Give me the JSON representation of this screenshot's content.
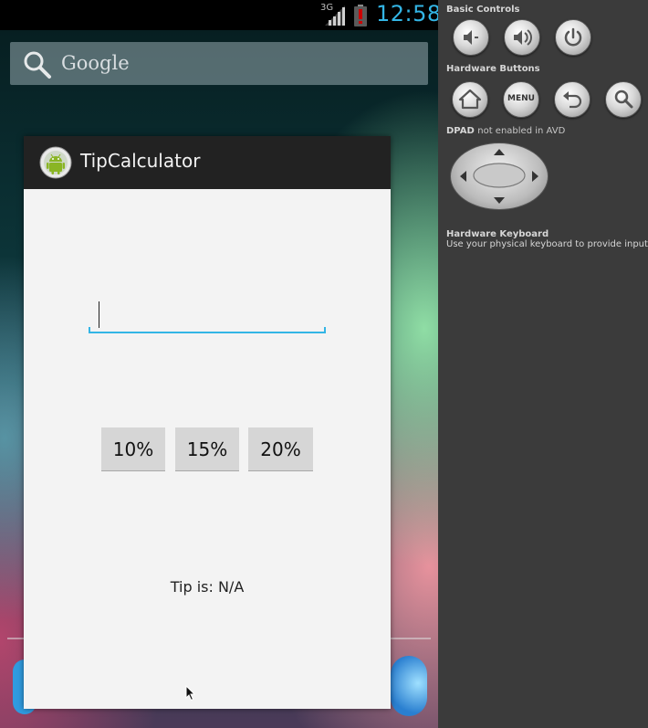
{
  "status_bar": {
    "network": "3G",
    "time": "12:58",
    "signal_icon": "signal-bars-icon",
    "battery_icon": "battery-alert-icon",
    "battery_color": "#cc0000",
    "time_color": "#33b5e5"
  },
  "home_screen": {
    "search_label": "Google",
    "search_icon": "search-icon"
  },
  "app": {
    "title": "TipCalculator",
    "icon": "android-app-icon",
    "amount_input": {
      "value": "",
      "placeholder": ""
    },
    "accent_color": "#33b5e5",
    "buttons": [
      {
        "label": "10%"
      },
      {
        "label": "15%"
      },
      {
        "label": "20%"
      }
    ],
    "tip_result": "Tip is: N/A"
  },
  "controls": {
    "basic_controls_title": "Basic Controls",
    "hardware_buttons_title": "Hardware Buttons",
    "menu_label": "MENU",
    "dpad_title": "DPAD",
    "dpad_note": "not enabled in AVD",
    "keyboard_title": "Hardware Keyboard",
    "keyboard_note": "Use your physical keyboard to provide input",
    "basic_buttons": [
      "volume-down-icon",
      "volume-up-icon",
      "power-icon"
    ],
    "hardware_buttons": [
      "home-icon",
      "menu-button",
      "back-icon",
      "search-icon"
    ]
  }
}
